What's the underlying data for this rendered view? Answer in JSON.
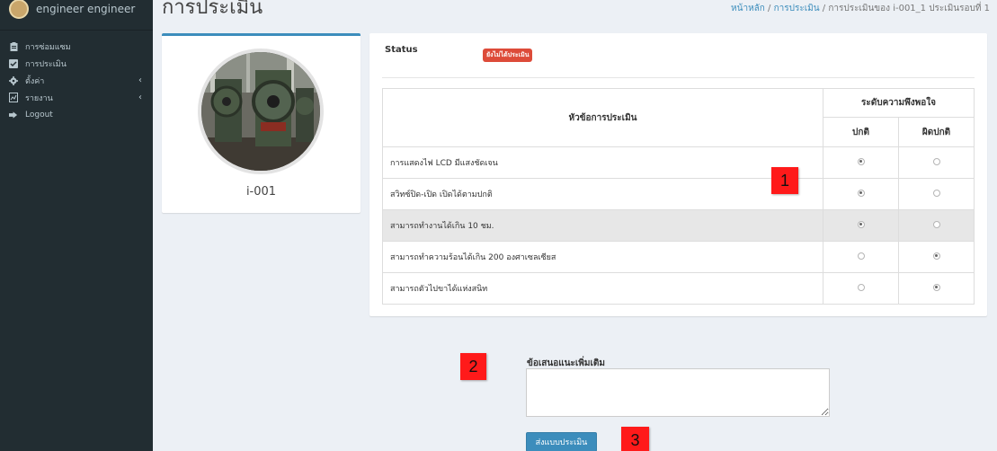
{
  "user": {
    "name": "engineer engineer"
  },
  "sidebar": {
    "items": [
      {
        "label": "การซ่อมแซม",
        "icon": "clipboard-icon",
        "chevron": ""
      },
      {
        "label": "การประเมิน",
        "icon": "checkbox-icon",
        "chevron": ""
      },
      {
        "label": "ตั้งค่า",
        "icon": "gear-icon",
        "chevron": "‹"
      },
      {
        "label": "รายงาน",
        "icon": "report-icon",
        "chevron": "‹"
      },
      {
        "label": "Logout",
        "icon": "sign-out-icon",
        "chevron": ""
      }
    ]
  },
  "header": {
    "title": "การประเมิน",
    "breadcrumb": {
      "home": "หน้าหลัก",
      "sep1": " / ",
      "section": "การประเมิน",
      "sep2": " / ",
      "current": "การประเมินของ i-001_1 ประเมินรอบที่ 1"
    }
  },
  "profile": {
    "name": "i-001"
  },
  "evaluation": {
    "status_label": "Status",
    "status_value": "ยังไม่ได้ประเมิน",
    "colors": {
      "status": "#dd4b39",
      "accent": "#3c8dbc"
    },
    "headers": {
      "topic": "หัวข้อการประเมิน",
      "satisfaction": "ระดับความพึงพอใจ",
      "normal": "ปกติ",
      "abnormal": "ผิดปกติ"
    },
    "rows": [
      {
        "topic": "การแสดงไฟ LCD มีแสงชัดเจน",
        "selected": "normal"
      },
      {
        "topic": "สวิทซ์ปิด-เปิด เปิดได้ตามปกติ",
        "selected": "normal"
      },
      {
        "topic": "สามารถทำงานได้เกิน 10 ชม.",
        "selected": "normal"
      },
      {
        "topic": "สามารถทำความร้อนได้เกิน 200 องศาเซลเซียส",
        "selected": "abnormal"
      },
      {
        "topic": "สามารถตัวไปขาได้แห่งสนิท",
        "selected": "abnormal"
      }
    ]
  },
  "suggestion": {
    "label": "ข้อเสนอแนะเพิ่มเติม",
    "value": "",
    "placeholder": ""
  },
  "submit": {
    "label": "ส่งแบบประเมิน"
  },
  "markers": [
    "1",
    "2",
    "3"
  ]
}
